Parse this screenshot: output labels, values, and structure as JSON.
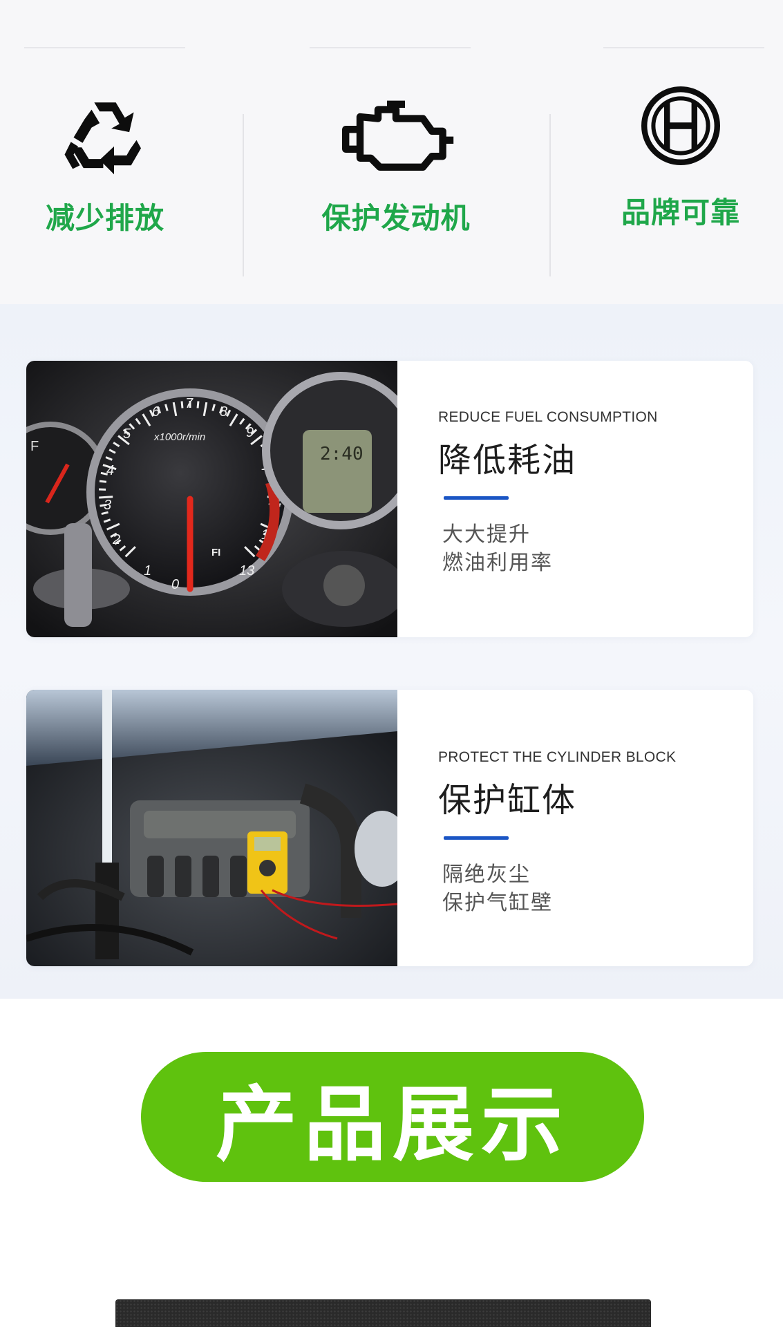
{
  "features": [
    {
      "label": "减少排放",
      "icon": "recycle-icon"
    },
    {
      "label": "保护发动机",
      "icon": "engine-icon"
    },
    {
      "label": "品牌可靠",
      "icon": "bosch-logo-icon"
    }
  ],
  "benefits": [
    {
      "en": "REDUCE FUEL CONSUMPTION",
      "cn": "降低耗油",
      "desc_line1": "大大提升",
      "desc_line2": "燃油利用率",
      "image": "dashboard-gauge-photo",
      "gauge_labels": [
        "x1000r/min",
        "2:40",
        "FI"
      ]
    },
    {
      "en": "PROTECT THE CYLINDER BLOCK",
      "cn": "保护缸体",
      "desc_line1": "隔绝灰尘",
      "desc_line2": "保护气缸壁",
      "image": "engine-bay-photo"
    }
  ],
  "product_section": {
    "title": "产品展示"
  },
  "colors": {
    "feature_green": "#1fa74a",
    "accent_blue": "#1a55c4",
    "pill_green": "#5fc20e"
  }
}
